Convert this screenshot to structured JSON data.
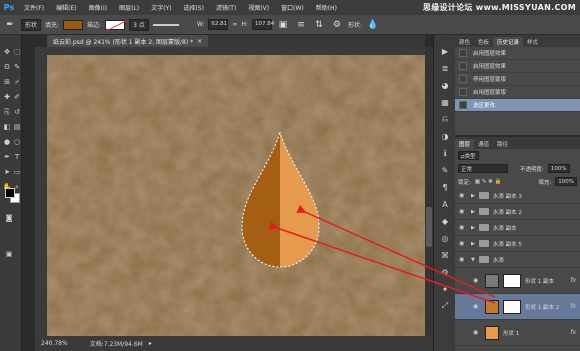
{
  "app": {
    "logo": "Ps"
  },
  "menu": [
    "文件(F)",
    "编辑(E)",
    "图像(I)",
    "图层(L)",
    "文字(Y)",
    "选择(S)",
    "滤镜(T)",
    "视图(V)",
    "窗口(W)",
    "帮助(H)"
  ],
  "watermark": {
    "text": "思缘设计论坛",
    "site": "www.MISSYUAN.COM"
  },
  "options": {
    "mode": "形状",
    "fill_label": "填充:",
    "stroke_label": "描边:",
    "stroke_size": "3 点",
    "w_label": "W:",
    "w_value": "62.81",
    "h_label": "H:",
    "h_value": "107.84",
    "shape_label": "形状:",
    "fill_color": "#9a5a12"
  },
  "document": {
    "tab": "纸云彩.psd @ 241% (形状 1 副本 2, 图层蒙版/8) *",
    "close": "×"
  },
  "status": {
    "zoom": "240.78%",
    "doc": "文档:7.23M/94.6M"
  },
  "history": {
    "tabs": [
      "颜色",
      "色板",
      "历史记录",
      "样式"
    ],
    "items": [
      "启用图层效果",
      "启用图层效果",
      "停用图层蒙版",
      "启用图层蒙版",
      "选区更改"
    ]
  },
  "layers": {
    "tabs": [
      "图层",
      "通道",
      "路径"
    ],
    "filter": "ρ类型",
    "blend": "正常",
    "opacity_label": "不透明度:",
    "opacity": "100%",
    "lock_label": "锁定:",
    "fill_label": "填充:",
    "fill": "100%",
    "rows": [
      {
        "name": "水滴 副本 3",
        "kind": "group"
      },
      {
        "name": "水滴 副本 2",
        "kind": "group"
      },
      {
        "name": "水滴 副本",
        "kind": "group"
      },
      {
        "name": "水滴 副本 5",
        "kind": "group"
      },
      {
        "name": "水滴",
        "kind": "group-open"
      },
      {
        "name": "形状 1 副本",
        "kind": "layer"
      },
      {
        "name": "形状 1 副本 2",
        "kind": "layer"
      },
      {
        "name": "形状 1",
        "kind": "layer"
      }
    ]
  },
  "colors": {
    "canvas_bg": "#8b6e49",
    "drop_dark": "#a55f14",
    "drop_light": "#e59a4d",
    "arrow": "#e41e1e",
    "selection": "#7d95b1"
  }
}
